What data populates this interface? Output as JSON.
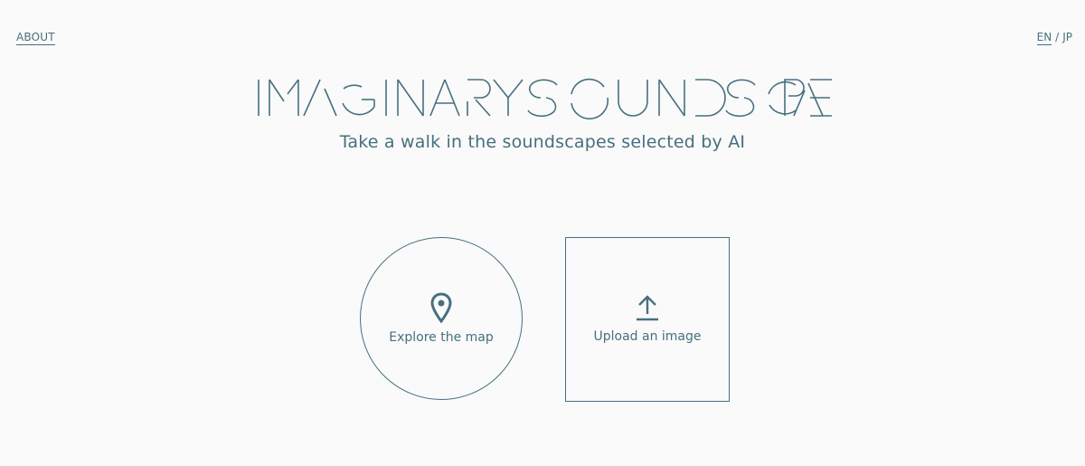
{
  "header": {
    "about_label": "ABOUT",
    "lang_en": "EN",
    "lang_sep": "/",
    "lang_jp": "JP"
  },
  "hero": {
    "logo_text": "IMAGINARY SOUNDSCAPE",
    "subtitle": "Take a walk in the soundscapes selected by AI"
  },
  "actions": {
    "explore_label": "Explore the map",
    "upload_label": "Upload an image"
  },
  "icons": {
    "explore": "map-pin-icon",
    "upload": "upload-arrow-icon"
  },
  "colors": {
    "accent": "#46707f",
    "background": "#fafafa"
  }
}
